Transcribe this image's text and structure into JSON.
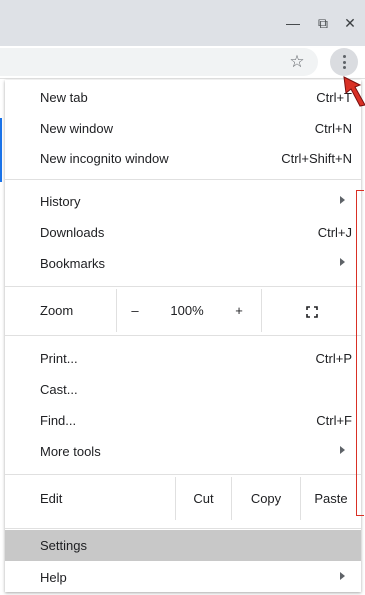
{
  "window": {
    "minimize": "—",
    "restore": "⧉",
    "close": "✕"
  },
  "toolbar": {
    "star": "☆"
  },
  "menu": {
    "new_tab": {
      "label": "New tab",
      "shortcut": "Ctrl+T"
    },
    "new_window": {
      "label": "New window",
      "shortcut": "Ctrl+N"
    },
    "new_incognito": {
      "label": "New incognito window",
      "shortcut": "Ctrl+Shift+N"
    },
    "history": {
      "label": "History"
    },
    "downloads": {
      "label": "Downloads",
      "shortcut": "Ctrl+J"
    },
    "bookmarks": {
      "label": "Bookmarks"
    },
    "zoom": {
      "label": "Zoom",
      "minus": "–",
      "level": "100%",
      "plus": "+"
    },
    "print": {
      "label": "Print...",
      "shortcut": "Ctrl+P"
    },
    "cast": {
      "label": "Cast..."
    },
    "find": {
      "label": "Find...",
      "shortcut": "Ctrl+F"
    },
    "more_tools": {
      "label": "More tools"
    },
    "edit": {
      "label": "Edit",
      "cut": "Cut",
      "copy": "Copy",
      "paste": "Paste"
    },
    "settings": {
      "label": "Settings"
    },
    "help": {
      "label": "Help"
    }
  },
  "colors": {
    "highlight": "#c8c8c8",
    "annotation_red": "#d93025",
    "titlebar": "#dee1e6"
  }
}
